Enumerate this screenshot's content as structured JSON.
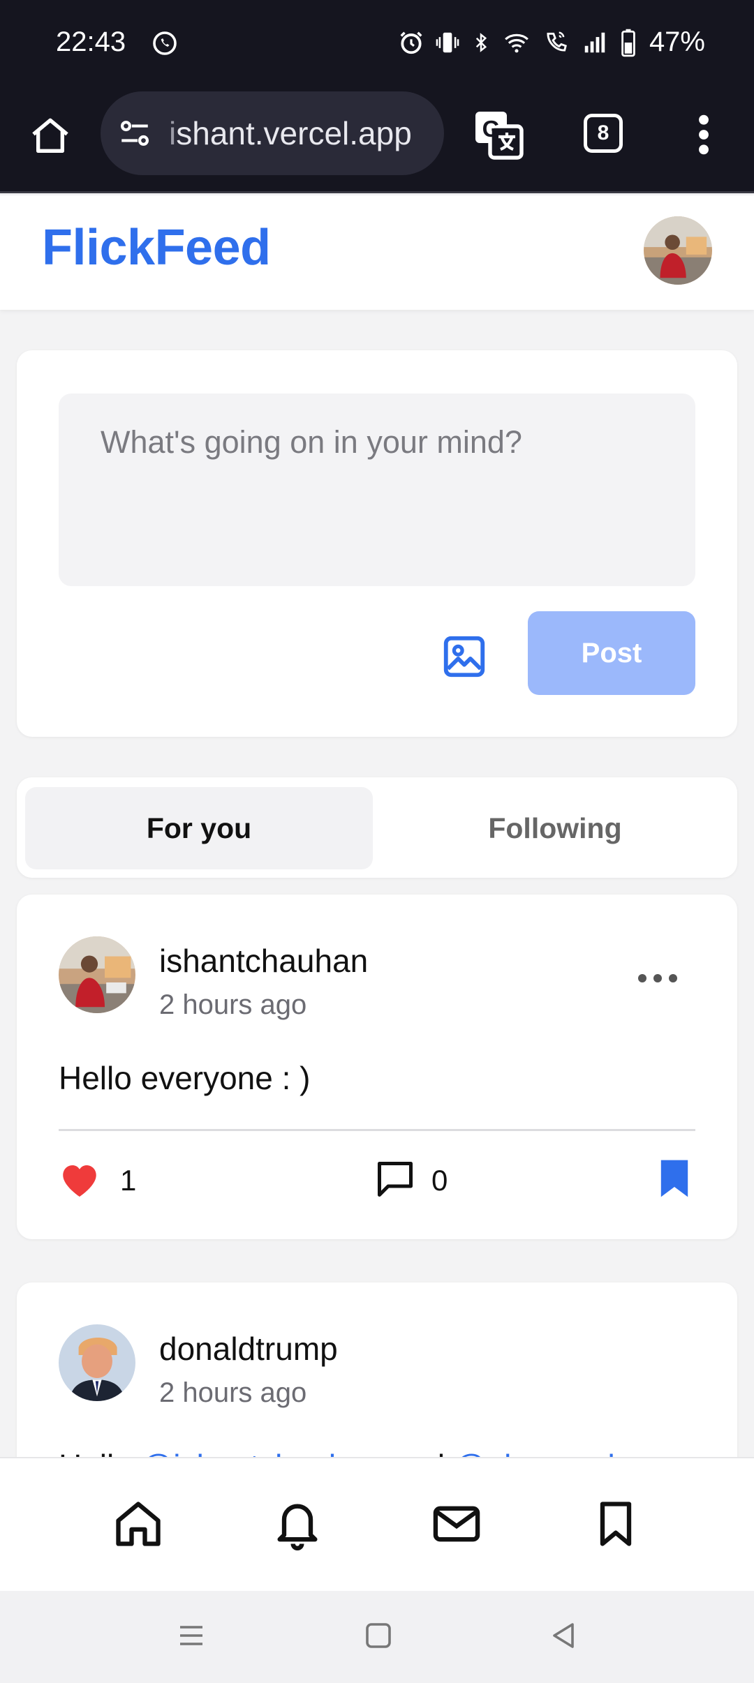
{
  "status_bar": {
    "time": "22:43",
    "battery_percent": "47%",
    "icons": [
      "whatsapp-icon",
      "alarm-icon",
      "vibrate-icon",
      "bluetooth-icon",
      "wifi-icon",
      "wifi-calling-icon",
      "signal-icon",
      "battery-icon"
    ]
  },
  "browser": {
    "url_faded": "i",
    "url_rest": "shant.vercel.app",
    "tab_count": "8",
    "icons": [
      "home-icon",
      "site-settings-icon",
      "translate-icon",
      "tabs-icon",
      "more-vert-icon"
    ]
  },
  "header": {
    "logo": "FlickFeed"
  },
  "compose": {
    "placeholder": "What's going on in your mind?",
    "post_label": "Post"
  },
  "tabs": [
    {
      "label": "For you",
      "active": true
    },
    {
      "label": "Following",
      "active": false
    }
  ],
  "posts": [
    {
      "username": "ishantchauhan",
      "time": "2 hours ago",
      "body": "Hello everyone : )",
      "likes": "1",
      "comments": "0",
      "liked": true,
      "bookmarked": true
    },
    {
      "username": "donaldtrump",
      "time": "2 hours ago",
      "body_prefix": "Hello ",
      "mention_1": "@ishantchauhan",
      "body_middle": " and ",
      "mention_2": "@elonmusk"
    }
  ],
  "colors": {
    "brand": "#2f6fec",
    "post_button_disabled": "#9bb8fb",
    "like": "#ef3b3b",
    "dark_chrome": "#15151f"
  },
  "bottom_nav": [
    "home-icon",
    "notifications-icon",
    "messages-icon",
    "bookmarks-icon"
  ],
  "system_nav": [
    "recents-icon",
    "home-square-icon",
    "back-icon"
  ]
}
